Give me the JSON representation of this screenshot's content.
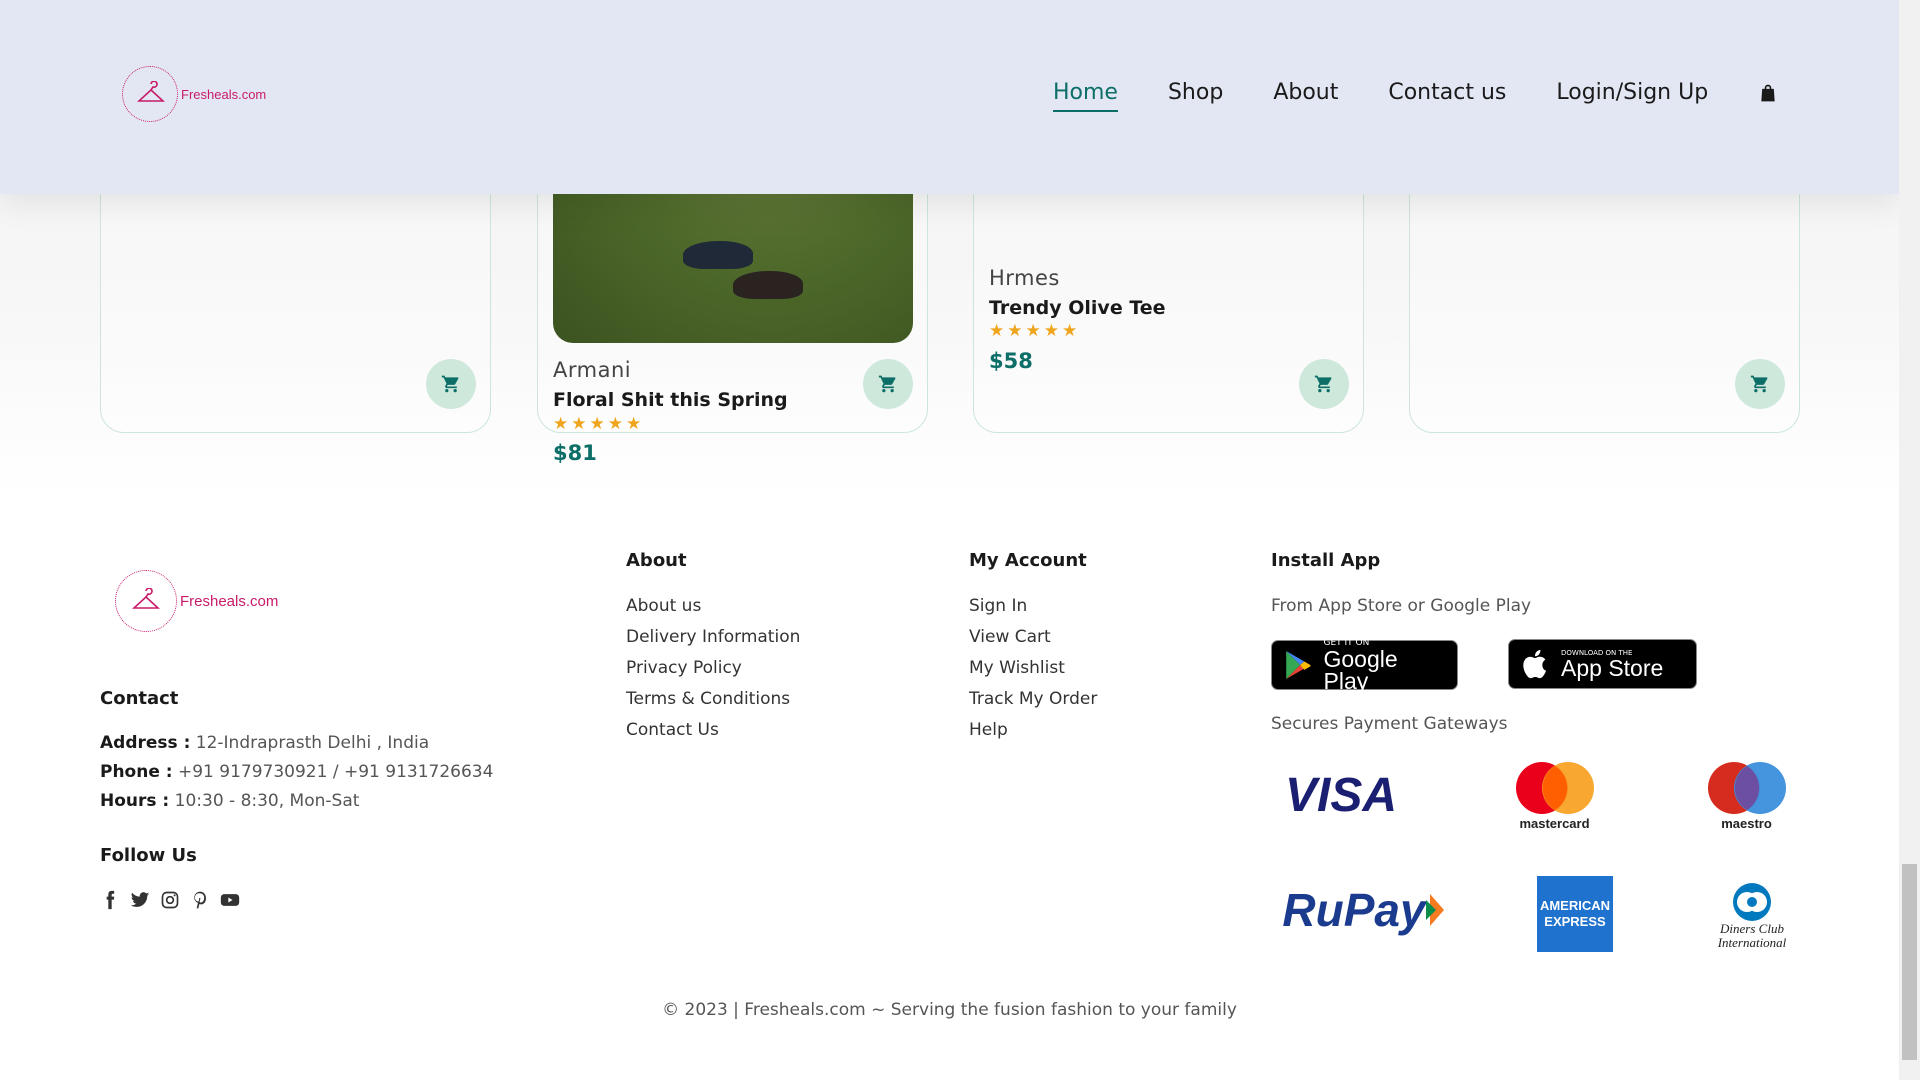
{
  "header": {
    "logo_text": "Fresheals.com",
    "nav": [
      {
        "label": "Home",
        "active": true
      },
      {
        "label": "Shop",
        "active": false
      },
      {
        "label": "About",
        "active": false
      },
      {
        "label": "Contact us",
        "active": false
      },
      {
        "label": "Login/Sign Up",
        "active": false
      }
    ],
    "cart_icon": "shopping-bag-icon"
  },
  "products": [
    {
      "brand": "",
      "name": "",
      "price": ""
    },
    {
      "brand": "Armani",
      "name": "Floral Shit this Spring",
      "rating": 5,
      "price": "$81"
    },
    {
      "brand": "Hrmes",
      "name": "Trendy Olive Tee",
      "rating": 5,
      "price": "$58"
    },
    {
      "brand": "",
      "name": "",
      "price": ""
    }
  ],
  "stars_text": "★★★★★",
  "footer": {
    "logo_text": "Fresheals.com",
    "contact": {
      "heading": "Contact",
      "address_label": "Address :",
      "address": "12-Indraprasth Delhi , India",
      "phone_label": "Phone :",
      "phone": "+91 9179730921 / +91 9131726634",
      "hours_label": "Hours :",
      "hours": "10:30 - 8:30, Mon-Sat"
    },
    "follow": {
      "heading": "Follow Us",
      "icons": [
        "facebook-icon",
        "twitter-icon",
        "instagram-icon",
        "pinterest-icon",
        "youtube-icon"
      ]
    },
    "about": {
      "heading": "About",
      "links": [
        "About us",
        "Delivery Information",
        "Privacy Policy",
        "Terms & Conditions",
        "Contact Us"
      ]
    },
    "account": {
      "heading": "My Account",
      "links": [
        "Sign In",
        "View Cart",
        "My Wishlist",
        "Track My Order",
        "Help"
      ]
    },
    "install": {
      "heading": "Install App",
      "subtitle": "From App Store or Google Play",
      "google_small": "GET IT ON",
      "google_big": "Google Play",
      "apple_small": "Download on the",
      "apple_big": "App Store",
      "payments_label": "Secures Payment Gateways",
      "payments": [
        "VISA",
        "mastercard",
        "maestro",
        "RuPay",
        "AMERICAN EXPRESS",
        "Diners Club International"
      ]
    },
    "copyright": "© 2023 | Fresheals.com ~ Serving the fusion fashion to your family"
  },
  "colors": {
    "accent": "#0d6e68",
    "header_bg": "#e3e7f4",
    "star": "#f0a51e",
    "logo": "#c81b6a"
  }
}
